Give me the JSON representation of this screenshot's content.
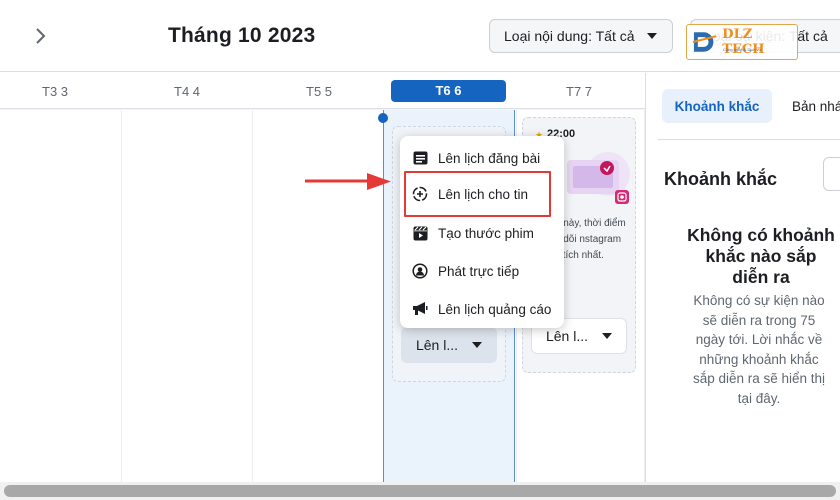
{
  "header": {
    "month_title": "Tháng 10 2023",
    "content_filter_label": "Loại nội dung: Tất cả",
    "second_filter_label": "Loại sự kiện: Tất cả"
  },
  "logo": {
    "text": "DLZ TECH",
    "subtext": "Công nghệ & Dịch vụ"
  },
  "days": [
    {
      "label": "T3 3"
    },
    {
      "label": "T4 4"
    },
    {
      "label": "T5 5"
    },
    {
      "label": "T6 6",
      "today": true
    },
    {
      "label": "T7 7"
    }
  ],
  "today_card": {
    "schedule_button_label": "Lên l..."
  },
  "next_card": {
    "time": "22:00",
    "description": "tuần này, thời điểm theo dõi nstagram lộng tích nhất.",
    "schedule_button_label": "Lên l..."
  },
  "menu": {
    "items": [
      {
        "label": "Lên lịch đăng bài",
        "icon": "post-icon"
      },
      {
        "label": "Lên lịch cho tin",
        "icon": "story-icon"
      },
      {
        "label": "Tạo thước phim",
        "icon": "reel-icon"
      },
      {
        "label": "Phát trực tiếp",
        "icon": "live-icon"
      },
      {
        "label": "Lên lịch quảng cáo",
        "icon": "megaphone-icon"
      }
    ]
  },
  "sidebar": {
    "tab_active": "Khoảnh khắc",
    "tab_other": "Bản nháp",
    "heading": "Khoảnh khắc",
    "empty_title": "Không có khoảnh khắc nào sắp diễn ra",
    "empty_description": "Không có sự kiện nào sẽ diễn ra trong 75 ngày tới. Lời nhắc về những khoảnh khắc sắp diễn ra sẽ hiển thị tại đây."
  },
  "colors": {
    "accent": "#1565c0",
    "highlight_box": "#e53935",
    "arrow": "#e53935"
  }
}
